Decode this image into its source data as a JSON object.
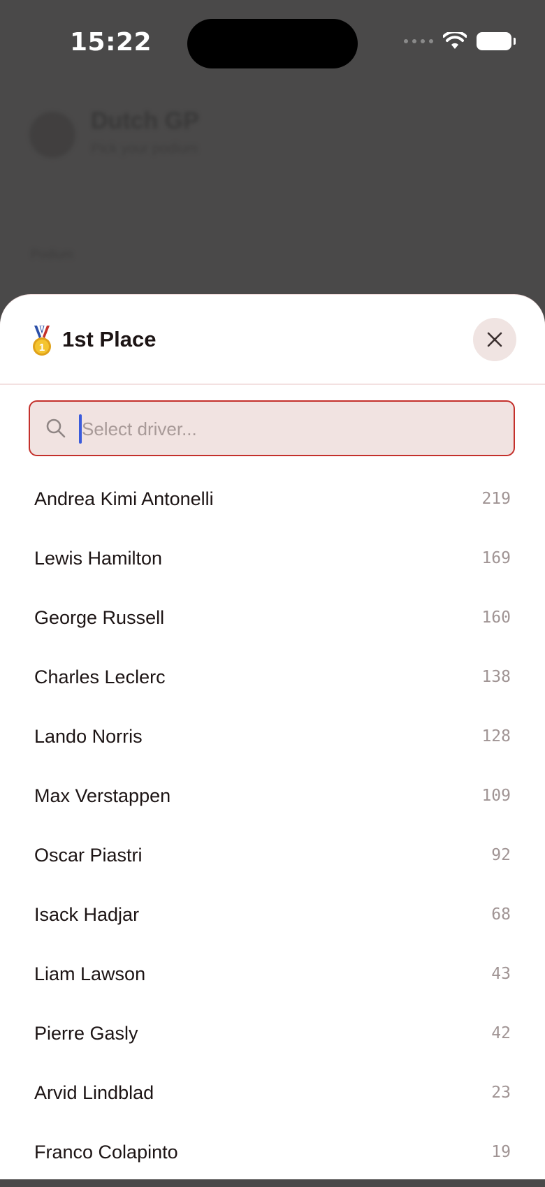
{
  "status_bar": {
    "time": "15:22"
  },
  "background": {
    "title": "Dutch GP",
    "subtitle": "Pick your podium",
    "section": "Podium"
  },
  "sheet": {
    "title": "1st Place",
    "medal_icon": "gold-medal-icon",
    "close_icon": "close-icon"
  },
  "search": {
    "placeholder": "Select driver...",
    "value": ""
  },
  "drivers": [
    {
      "name": "Andrea Kimi Antonelli",
      "points": "219"
    },
    {
      "name": "Lewis Hamilton",
      "points": "169"
    },
    {
      "name": "George Russell",
      "points": "160"
    },
    {
      "name": "Charles Leclerc",
      "points": "138"
    },
    {
      "name": "Lando Norris",
      "points": "128"
    },
    {
      "name": "Max Verstappen",
      "points": "109"
    },
    {
      "name": "Oscar Piastri",
      "points": "92"
    },
    {
      "name": "Isack Hadjar",
      "points": "68"
    },
    {
      "name": "Liam Lawson",
      "points": "43"
    },
    {
      "name": "Pierre Gasly",
      "points": "42"
    },
    {
      "name": "Arvid Lindblad",
      "points": "23"
    },
    {
      "name": "Franco Colapinto",
      "points": "19"
    }
  ],
  "colors": {
    "accent_border": "#c4302b",
    "caret": "#3b5bdb",
    "input_bg": "#f1e3e1"
  }
}
